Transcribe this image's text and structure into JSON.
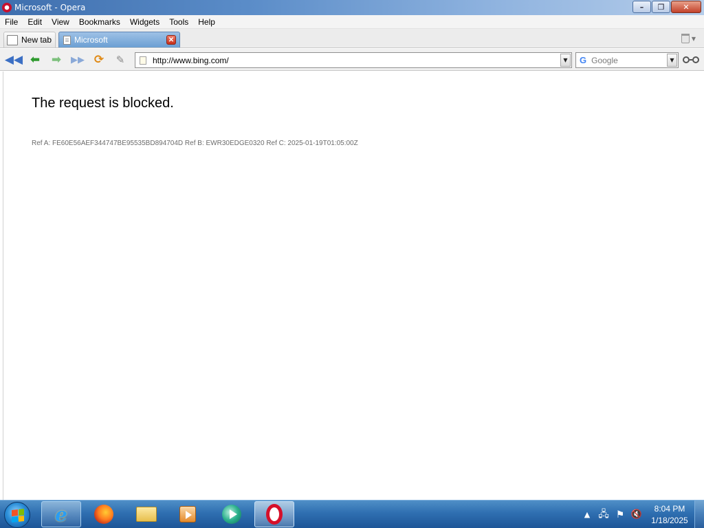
{
  "window": {
    "title": "Microsoft - Opera",
    "controls": {
      "minimize": "–",
      "maximize": "❐",
      "close": "✕"
    }
  },
  "menu": {
    "items": [
      "File",
      "Edit",
      "View",
      "Bookmarks",
      "Widgets",
      "Tools",
      "Help"
    ]
  },
  "tabs": [
    {
      "label": "New tab",
      "active": false
    },
    {
      "label": "Microsoft",
      "active": true
    }
  ],
  "toolbar": {
    "address": "http://www.bing.com/",
    "search_placeholder": "Google",
    "search_engine_icon": "G"
  },
  "page": {
    "heading": "The request is blocked.",
    "reference": "Ref A: FE60E56AEF344747BE95535BD894704D Ref B: EWR30EDGE0320 Ref C: 2025-01-19T01:05:00Z"
  },
  "taskbar": {
    "apps": [
      "internet-explorer",
      "firefox",
      "file-explorer",
      "media-player",
      "media-center",
      "opera"
    ],
    "clock": {
      "time": "8:04 PM",
      "date": "1/18/2025"
    }
  },
  "colors": {
    "titlebar": "#3f6fae",
    "active_tab": "#6b9fd3",
    "taskbar": "#2f6fb1",
    "reference_text": "#6b6b6b"
  }
}
